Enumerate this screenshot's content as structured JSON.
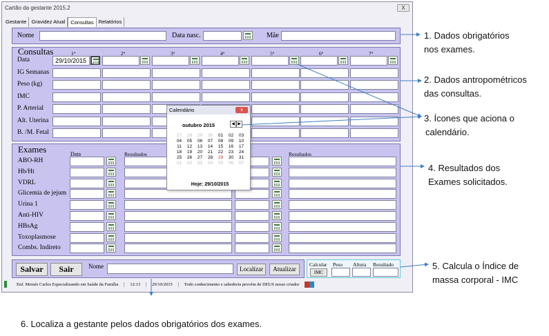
{
  "window": {
    "title": "Cartão da gestante 2015.2",
    "close": "X"
  },
  "tabs": [
    "Gestante",
    "Gravidez Atual",
    "Consultas",
    "Relatórios"
  ],
  "patient": {
    "nome": "Nome",
    "data_nasc": "Data nasc.",
    "mae": "Mãe"
  },
  "consultas": {
    "title": "Consultas",
    "columns": [
      "1ª",
      "2ª",
      "3ª",
      "4ª",
      "5ª",
      "6ª",
      "7ª"
    ],
    "rows": [
      "Data",
      "IG Semanas",
      "Peso (kg)",
      "IMC",
      "P. Arterial",
      "Alt. Uterina",
      "B. /M. Fetal"
    ],
    "first_date": "29/10/2015"
  },
  "calendar": {
    "title": "Calendário",
    "month": "outubro 2015",
    "prev": "◀",
    "next": "▶",
    "weeks": [
      [
        "27",
        "28",
        "29",
        "30",
        "01",
        "02",
        "03"
      ],
      [
        "04",
        "05",
        "06",
        "07",
        "08",
        "09",
        "10"
      ],
      [
        "11",
        "12",
        "13",
        "14",
        "15",
        "16",
        "17"
      ],
      [
        "18",
        "19",
        "20",
        "21",
        "22",
        "23",
        "24"
      ],
      [
        "25",
        "26",
        "27",
        "28",
        "29",
        "30",
        "31"
      ],
      [
        "01",
        "02",
        "03",
        "04",
        "05",
        "06",
        "07"
      ]
    ],
    "today": "Hoje: 29/10/2015"
  },
  "exames": {
    "title": "Exames",
    "data_header": "Data",
    "result_header": "Resultados",
    "result_header_right": "Resultados",
    "items": [
      "ABO-RH",
      "Hb/Ht",
      "VDRL",
      "Glicemia de jejum",
      "Urina 1",
      "Anti-HIV",
      "HBsAg",
      "Toxoplasmose",
      "Combs. Indireto"
    ]
  },
  "bottom": {
    "salvar": "Salvar",
    "sair": "Sair",
    "nome": "Nome",
    "localizar": "Localizar",
    "atualizar": "Atualizar",
    "calcular": "Calcular",
    "peso": "Peso",
    "altura": "Altura",
    "resultado": "Resultado",
    "imc_btn": "IMC"
  },
  "status": {
    "user": "Enf. Moisés Carlos Especializando em Saúde da Família",
    "time": "12:13",
    "date": "29/10/2015",
    "motto": "Todo conhecimento e sabedoria provém de DEUS nosso criador"
  },
  "annotations": {
    "a1_line1": "1.   Dados obrigatórios",
    "a1_line2": "nos exames.",
    "a2_line1": "2. Dados antropométricos",
    "a2_line2": "das consultas.",
    "a3_line1": "3. Ícones que aciona o",
    "a3_line2": "calendário.",
    "a4_line1": "4. Resultados dos",
    "a4_line2": "Exames solicitados.",
    "a5_line1": "5. Calcula o Índice de",
    "a5_line2": "massa corporal  - IMC",
    "a6": "6. Localiza a gestante pelos dados obrigatórios dos exames."
  }
}
